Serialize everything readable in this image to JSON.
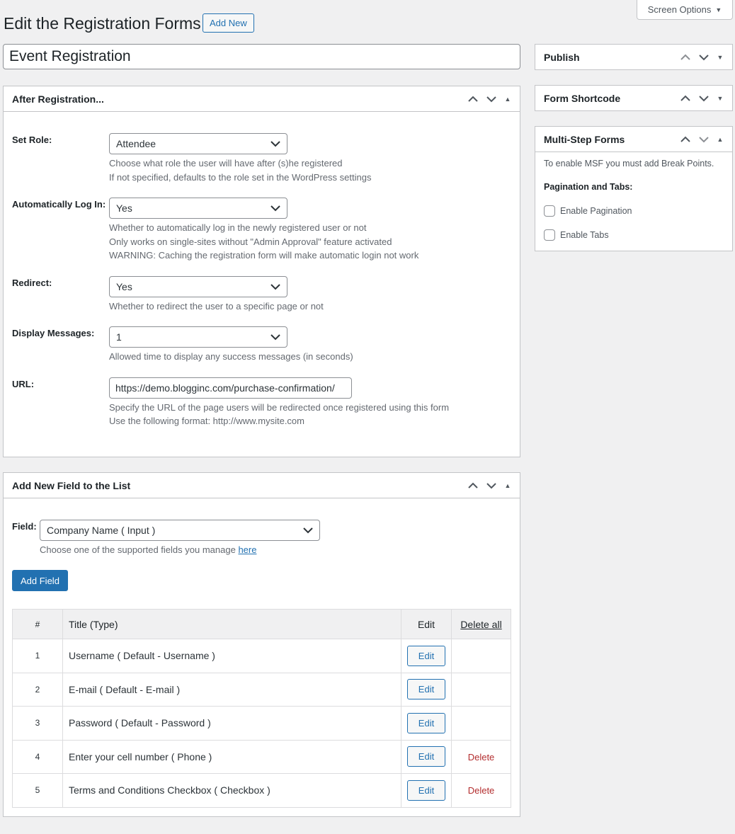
{
  "header": {
    "screen_options": "Screen Options",
    "title": "Edit the Registration Forms",
    "add_new": "Add New"
  },
  "form_title": "Event Registration",
  "after_registration": {
    "title": "After Registration...",
    "set_role": {
      "label": "Set Role:",
      "value": "Attendee",
      "desc1": "Choose what role the user will have after (s)he registered",
      "desc2": "If not specified, defaults to the role set in the WordPress settings"
    },
    "auto_login": {
      "label": "Automatically Log In:",
      "value": "Yes",
      "desc1": "Whether to automatically log in the newly registered user or not",
      "desc2": "Only works on single-sites without \"Admin Approval\" feature activated",
      "desc3": "WARNING: Caching the registration form will make automatic login not work"
    },
    "redirect": {
      "label": "Redirect:",
      "value": "Yes",
      "desc1": "Whether to redirect the user to a specific page or not"
    },
    "display_messages": {
      "label": "Display Messages:",
      "value": "1",
      "desc1": "Allowed time to display any success messages (in seconds)"
    },
    "url": {
      "label": "URL:",
      "value": "https://demo.blogginc.com/purchase-confirmation/",
      "desc1": "Specify the URL of the page users will be redirected once registered using this form",
      "desc2": "Use the following format: http://www.mysite.com"
    }
  },
  "add_field": {
    "title": "Add New Field to the List",
    "field_label": "Field:",
    "field_value": "Company Name ( Input )",
    "desc_prefix": "Choose one of the supported fields you manage",
    "desc_link": "here",
    "button": "Add Field",
    "table": {
      "headers": {
        "num": "#",
        "title": "Title (Type)",
        "edit": "Edit",
        "delete_all": "Delete all"
      },
      "rows": [
        {
          "num": "1",
          "title": "Username ( Default - Username )",
          "edit": "Edit",
          "delete": ""
        },
        {
          "num": "2",
          "title": "E-mail ( Default - E-mail )",
          "edit": "Edit",
          "delete": ""
        },
        {
          "num": "3",
          "title": "Password ( Default - Password )",
          "edit": "Edit",
          "delete": ""
        },
        {
          "num": "4",
          "title": "Enter your cell number ( Phone )",
          "edit": "Edit",
          "delete": "Delete"
        },
        {
          "num": "5",
          "title": "Terms and Conditions Checkbox ( Checkbox )",
          "edit": "Edit",
          "delete": "Delete"
        }
      ]
    }
  },
  "sidebar": {
    "publish": "Publish",
    "form_shortcode": "Form Shortcode",
    "multi_step": {
      "title": "Multi-Step Forms",
      "desc": "To enable MSF you must add Break Points.",
      "section": "Pagination and Tabs:",
      "enable_pagination": "Enable Pagination",
      "enable_tabs": "Enable Tabs",
      "enable_pagination_checked": false,
      "enable_tabs_checked": false
    }
  },
  "colors": {
    "accent": "#2271b1",
    "danger": "#b32d2e",
    "background": "#f0f0f1"
  }
}
